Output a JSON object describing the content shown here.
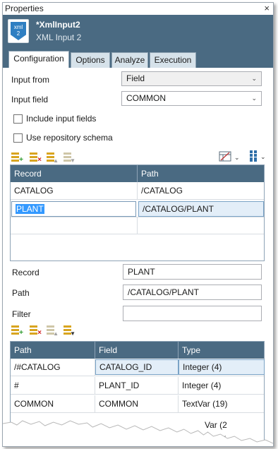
{
  "window": {
    "title": "Properties",
    "close_glyph": "×"
  },
  "header": {
    "title": "*XmlInput2",
    "subtitle": "XML Input 2",
    "icon_text_1": "xml",
    "icon_text_2": "2"
  },
  "tabs": [
    {
      "label": "Configuration",
      "active": true
    },
    {
      "label": "Options",
      "active": false
    },
    {
      "label": "Analyze",
      "active": false
    },
    {
      "label": "Execution",
      "active": false
    }
  ],
  "form": {
    "input_from_label": "Input from",
    "input_from_value": "Field",
    "input_field_label": "Input field",
    "input_field_value": "COMMON",
    "include_input_fields_label": "Include input fields",
    "use_repository_schema_label": "Use repository schema"
  },
  "record_grid": {
    "columns": [
      "Record",
      "Path"
    ],
    "rows": [
      {
        "record": "CATALOG",
        "path": "/CATALOG"
      },
      {
        "record": "PLANT",
        "path": "/CATALOG/PLANT"
      }
    ]
  },
  "record_details": {
    "record_label": "Record",
    "record_value": "PLANT",
    "path_label": "Path",
    "path_value": "/CATALOG/PLANT",
    "filter_label": "Filter",
    "filter_value": ""
  },
  "field_grid": {
    "columns": [
      "Path",
      "Field",
      "Type"
    ],
    "rows": [
      {
        "path": "/#CATALOG",
        "field": "CATALOG_ID",
        "type": "Integer (4)"
      },
      {
        "path": "#",
        "field": "PLANT_ID",
        "type": "Integer (4)"
      },
      {
        "path": "COMMON",
        "field": "COMMON",
        "type": "TextVar (19)"
      }
    ],
    "partial_type_1": "Var (2",
    "partial_type_2": "("
  },
  "colors": {
    "header_bg": "#4a6a82",
    "accent": "#2f7fc2",
    "selection": "#3399ff"
  }
}
